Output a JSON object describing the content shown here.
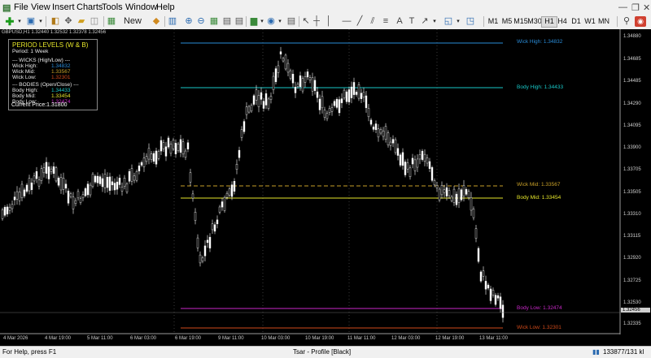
{
  "menu": {
    "items": [
      "File",
      "View",
      "Insert",
      "Charts",
      "Tools",
      "Window",
      "Help"
    ]
  },
  "toolbar": {
    "new_order": "New Order",
    "timeframes": [
      "M1",
      "M5",
      "M15",
      "M30",
      "H1",
      "H4",
      "D1",
      "W1",
      "MN"
    ],
    "active_timeframe": "H1"
  },
  "chart": {
    "symbol_header": "GBPUSD,H1  1.32440 1.32532 1.32378 1.32456",
    "panel": {
      "title": "PERIOD LEVELS (W & B)",
      "period": "Period: 1 Week",
      "wicks_header": "--- WICKS (High/Low) ---",
      "wick_high_label": "Wick High:",
      "wick_high_value": "1.34832",
      "wick_mid_label": "Wick Mid:",
      "wick_mid_value": "1.33567",
      "wick_low_label": "Wick Low:",
      "wick_low_value": "1.32301",
      "bodies_header": "--- BODIES (Open/Close) ---",
      "body_high_label": "Body High:",
      "body_high_value": "1.34433",
      "body_mid_label": "Body Mid:",
      "body_mid_value": "1.33454",
      "body_low_label": "Body Low:",
      "body_low_value": "1.32474",
      "current_price": "Current Price:1.31800"
    },
    "levels": {
      "wick_high": "Wick High: 1.34832",
      "body_high": "Body High: 1.34433",
      "wick_mid": "Wick Mid: 1.33567",
      "body_mid": "Body Mid: 1.33454",
      "body_low": "Body Low: 1.32474",
      "wick_low": "Wick Low: 1.32301"
    },
    "colors": {
      "wick_high": "#2a8cd8",
      "body_high": "#18c8c8",
      "wick_mid": "#c8a028",
      "body_mid": "#e6e62a",
      "body_low": "#c828c8",
      "wick_low": "#d04a1a",
      "candles": "#ffffff"
    },
    "price_axis": [
      "1.34880",
      "1.34685",
      "1.34485",
      "1.34290",
      "1.34095",
      "1.33900",
      "1.33705",
      "1.33505",
      "1.33310",
      "1.33115",
      "1.32920",
      "1.32725",
      "1.32530",
      "1.32456",
      "1.32335"
    ],
    "time_axis": [
      "4 Mar 2026",
      "4 Mar 19:00",
      "5 Mar 11:00",
      "6 Mar 03:00",
      "6 Mar 19:00",
      "9 Mar 11:00",
      "10 Mar 03:00",
      "10 Mar 19:00",
      "11 Mar 11:00",
      "12 Mar 03:00",
      "12 Mar 19:00",
      "13 Mar 11:00"
    ]
  },
  "statusbar": {
    "help": "For Help, press F1",
    "profile": "Tsar - Profile [Black]",
    "traffic": "133877/131 kl"
  }
}
